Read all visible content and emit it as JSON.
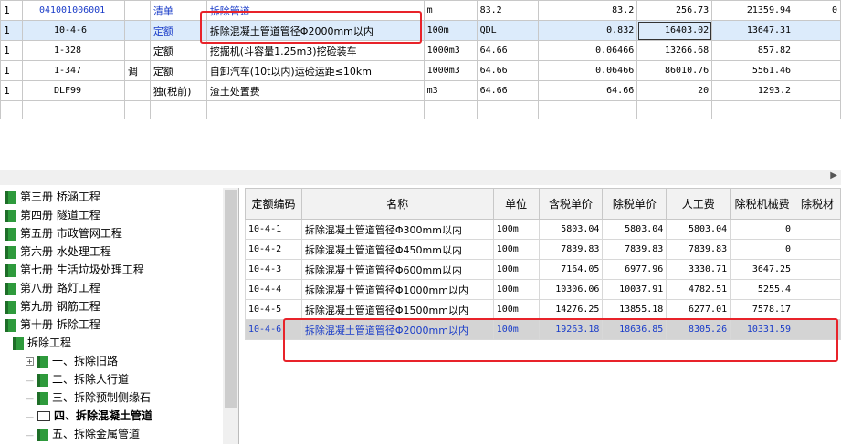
{
  "top_grid": {
    "rows": [
      {
        "no": "1",
        "code": "041001006001",
        "tiao": "",
        "type": "清单",
        "name": "拆除管道",
        "unit": "m",
        "qty": "83.2",
        "c1": "83.2",
        "c2": "256.73",
        "c3": "21359.94",
        "c4": "0"
      },
      {
        "no": "1",
        "code": "10-4-6",
        "tiao": "",
        "type": "定额",
        "name": "拆除混凝土管道管径Φ2000mm以内",
        "unit": "100m",
        "qty": "QDL",
        "c1": "0.832",
        "c2": "16403.02",
        "c3": "13647.31",
        "c4": ""
      },
      {
        "no": "1",
        "code": "1-328",
        "tiao": "",
        "type": "定额",
        "name": "挖掘机(斗容量1.25m3)挖硷装车",
        "unit": "1000m3",
        "qty": "64.66",
        "c1": "0.06466",
        "c2": "13266.68",
        "c3": "857.82",
        "c4": ""
      },
      {
        "no": "1",
        "code": "1-347",
        "tiao": "调",
        "type": "定额",
        "name": "自卸汽车(10t以内)运硷运距≤10km",
        "unit": "1000m3",
        "qty": "64.66",
        "c1": "0.06466",
        "c2": "86010.76",
        "c3": "5561.46",
        "c4": ""
      },
      {
        "no": "1",
        "code": "DLF99",
        "tiao": "",
        "type": "独(税前)",
        "name": "渣土处置费",
        "unit": "m3",
        "qty": "64.66",
        "c1": "64.66",
        "c2": "20",
        "c3": "1293.2",
        "c4": ""
      }
    ]
  },
  "tree": {
    "items": [
      {
        "label": "第三册 桥涵工程"
      },
      {
        "label": "第四册 隧道工程"
      },
      {
        "label": "第五册 市政管网工程"
      },
      {
        "label": "第六册 水处理工程"
      },
      {
        "label": "第七册 生活垃圾处理工程"
      },
      {
        "label": "第八册 路灯工程"
      },
      {
        "label": "第九册 钢筋工程"
      },
      {
        "label": "第十册 拆除工程"
      },
      {
        "label": "拆除工程"
      },
      {
        "label": "一、拆除旧路"
      },
      {
        "label": "二、拆除人行道"
      },
      {
        "label": "三、拆除预制侧缘石"
      },
      {
        "label": "四、拆除混凝土管道"
      },
      {
        "label": "五、拆除金属管道"
      }
    ]
  },
  "quota_table": {
    "headers": [
      "定额编码",
      "名称",
      "单位",
      "含税单价",
      "除税单价",
      "人工费",
      "除税机械费",
      "除税材"
    ],
    "rows": [
      {
        "code": "10-4-1",
        "name": "拆除混凝土管道管径Φ300mm以内",
        "unit": "100m",
        "tax_price": "5803.04",
        "notax_price": "5803.04",
        "labor": "5803.04",
        "machine": "0"
      },
      {
        "code": "10-4-2",
        "name": "拆除混凝土管道管径Φ450mm以内",
        "unit": "100m",
        "tax_price": "7839.83",
        "notax_price": "7839.83",
        "labor": "7839.83",
        "machine": "0"
      },
      {
        "code": "10-4-3",
        "name": "拆除混凝土管道管径Φ600mm以内",
        "unit": "100m",
        "tax_price": "7164.05",
        "notax_price": "6977.96",
        "labor": "3330.71",
        "machine": "3647.25"
      },
      {
        "code": "10-4-4",
        "name": "拆除混凝土管道管径Φ1000mm以内",
        "unit": "100m",
        "tax_price": "10306.06",
        "notax_price": "10037.91",
        "labor": "4782.51",
        "machine": "5255.4"
      },
      {
        "code": "10-4-5",
        "name": "拆除混凝土管道管径Φ1500mm以内",
        "unit": "100m",
        "tax_price": "14276.25",
        "notax_price": "13855.18",
        "labor": "6277.01",
        "machine": "7578.17"
      },
      {
        "code": "10-4-6",
        "name": "拆除混凝土管道管径Φ2000mm以内",
        "unit": "100m",
        "tax_price": "19263.18",
        "notax_price": "18636.85",
        "labor": "8305.26",
        "machine": "10331.59"
      }
    ]
  },
  "colors": {
    "highlight_red": "#e8232a",
    "selected_blue": "#dcebfb",
    "text_blue": "#1a3cc8",
    "book_green": "#2e9a3c"
  }
}
